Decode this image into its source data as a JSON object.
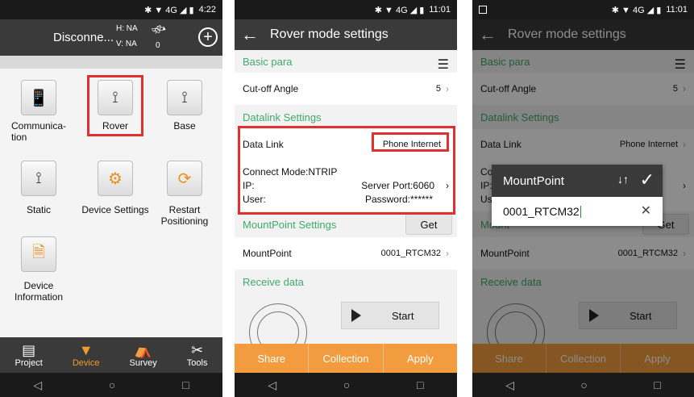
{
  "panel1": {
    "status": {
      "icons": "✱ ▼ 4G ◢ ▮",
      "time": "4:22"
    },
    "header": {
      "title": "Disconne...",
      "h": "H: NA",
      "v": "V: NA",
      "sat_count": "0",
      "add": "+"
    },
    "tiles": [
      {
        "label": "Communica-\ntion",
        "icon": "communication-icon"
      },
      {
        "label": "Rover",
        "icon": "rover-icon"
      },
      {
        "label": "Base",
        "icon": "base-icon"
      },
      {
        "label": "Static",
        "icon": "static-icon"
      },
      {
        "label": "Device Settings",
        "icon": "device-settings-icon"
      },
      {
        "label": "Restart\nPositioning",
        "icon": "restart-positioning-icon"
      },
      {
        "label": "Device\nInformation",
        "icon": "device-information-icon"
      }
    ],
    "tabs": [
      {
        "label": "Project",
        "active": false
      },
      {
        "label": "Device",
        "active": true
      },
      {
        "label": "Survey",
        "active": false
      },
      {
        "label": "Tools",
        "active": false
      }
    ]
  },
  "panel2": {
    "status": {
      "icons": "✱ ▼ 4G ◢ ▮",
      "time": "11:01"
    },
    "header": {
      "title": "Rover mode settings"
    },
    "basic_para": "Basic para",
    "cutoff_label": "Cut-off Angle",
    "cutoff_value": "5",
    "datalink_settings": "Datalink Settings",
    "data_link_label": "Data Link",
    "data_link_value": "Phone Internet",
    "connect_mode": "Connect Mode:NTRIP",
    "ip_label": "IP:",
    "server_port": "Server Port:6060",
    "user_label": "User:",
    "password": "Password:******",
    "mountpoint_settings": "MountPoint Settings",
    "get_label": "Get",
    "mountpoint_label": "MountPoint",
    "mountpoint_value": "0001_RTCM32",
    "receive_data": "Receive data",
    "start_label": "Start",
    "actions": [
      "Share",
      "Collection",
      "Apply"
    ]
  },
  "panel3": {
    "status": {
      "icons": "✱ ▼ 4G ◢ ▮",
      "time": "11:01"
    },
    "header": {
      "title": "Rover mode settings"
    },
    "basic_para": "Basic para",
    "cutoff_label": "Cut-off Angle",
    "cutoff_value": "5",
    "datalink_settings": "Datalink Settings",
    "data_link_label": "Data Link",
    "data_link_value": "Phone Internet",
    "connect_partial": "Con",
    "ip_label": "IP:",
    "user_partial": "User",
    "mountpoint_settings_partial": "Mount",
    "get_partial": "Get",
    "mountpoint_label": "MountPoint",
    "mountpoint_value": "0001_RTCM32",
    "receive_data": "Receive data",
    "start_label": "Start",
    "actions": [
      "Share",
      "Collection",
      "Apply"
    ],
    "dialog": {
      "title": "MountPoint",
      "value": "0001_RTCM32"
    }
  }
}
